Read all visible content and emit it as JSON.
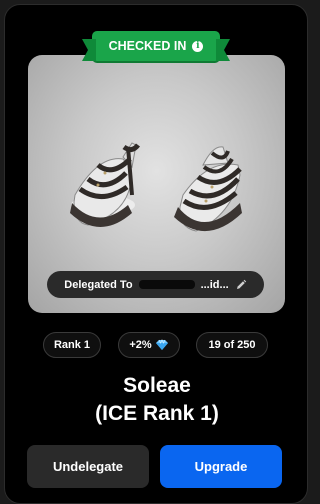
{
  "badge": {
    "label": "CHECKED IN",
    "icon": "info-icon"
  },
  "delegation": {
    "text": "Delegated To",
    "suffix": "...id...",
    "icon": "pencil-icon"
  },
  "stats": {
    "rank": "Rank 1",
    "bonus": "+2%",
    "bonus_icon": "diamond-icon",
    "supply": "19 of 250"
  },
  "item": {
    "title_line1": "Soleae",
    "title_line2": "(ICE Rank 1)"
  },
  "actions": {
    "undelegate_label": "Undelegate",
    "upgrade_label": "Upgrade"
  },
  "colors": {
    "badge": "#1aa54a",
    "primary": "#0a66f0",
    "secondary": "#2a2a2a",
    "background": "#000000"
  }
}
